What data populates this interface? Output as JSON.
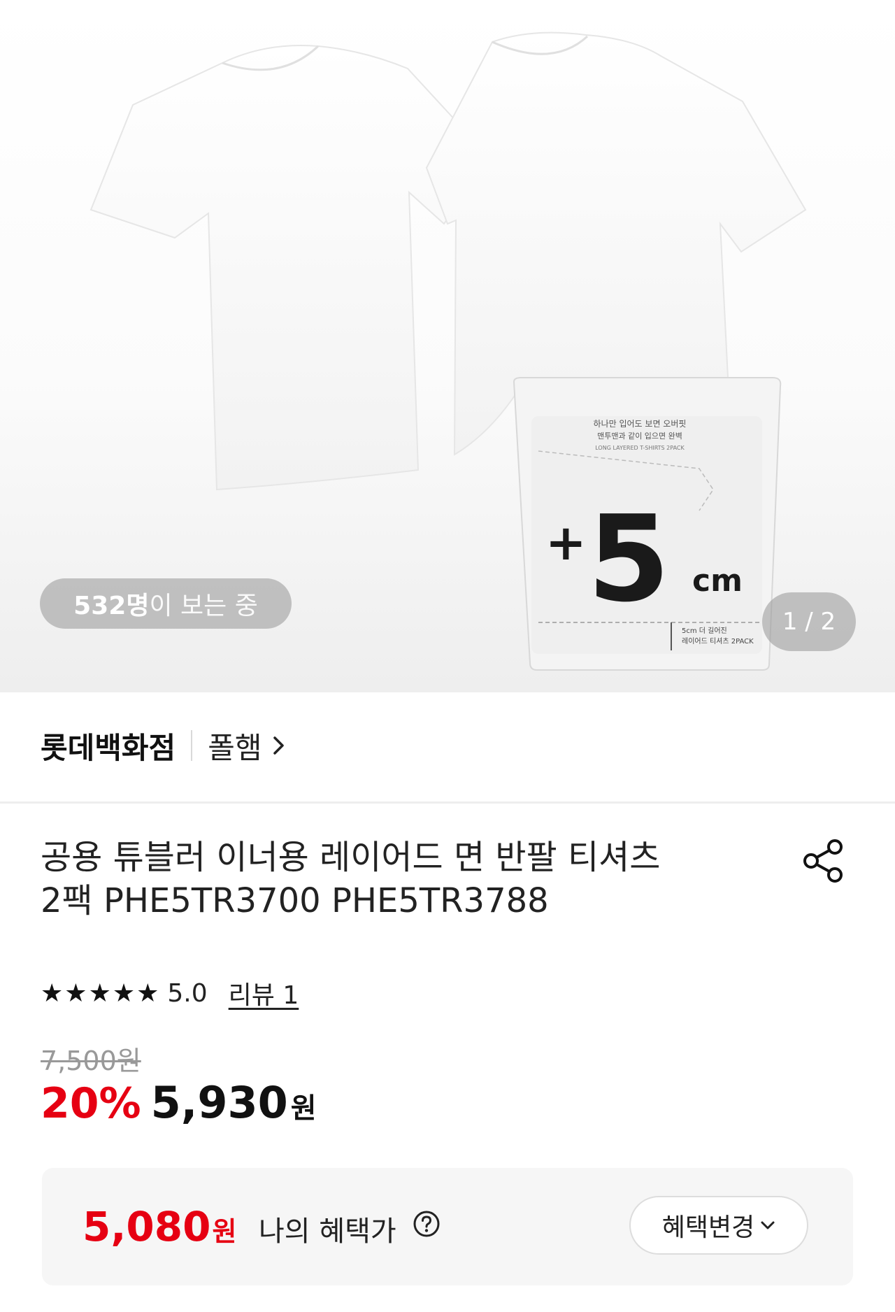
{
  "hero": {
    "image": "two-white-tshirts-with-package",
    "package_text": "+5cm",
    "viewers_count": "532명",
    "viewers_suffix": "이 보는 중",
    "pager": "1 / 2"
  },
  "brand_row": {
    "store": "롯데백화점",
    "brand": "폴햄",
    "chevron": "chevron-right-icon"
  },
  "product": {
    "title_line1": "공용 튜블러 이너용 레이어드 면 반팔 티셔츠",
    "title_line2": "2팩 PHE5TR3700 PHE5TR3788",
    "share_icon": "share-icon"
  },
  "rating": {
    "stars": 5,
    "score": "5.0",
    "reviews": "리뷰 1"
  },
  "price": {
    "original": "7,500원",
    "discount": "20%",
    "sale": "5,930",
    "unit": "원"
  },
  "benefit": {
    "price": "5,080",
    "unit": "원",
    "label": "나의 혜택가",
    "help_icon": "question-circle-icon",
    "change_label": "혜택변경",
    "change_icon": "chevron-down-icon"
  },
  "colors": {
    "accent_red": "#e60012",
    "text": "#111111",
    "muted": "#999999"
  }
}
